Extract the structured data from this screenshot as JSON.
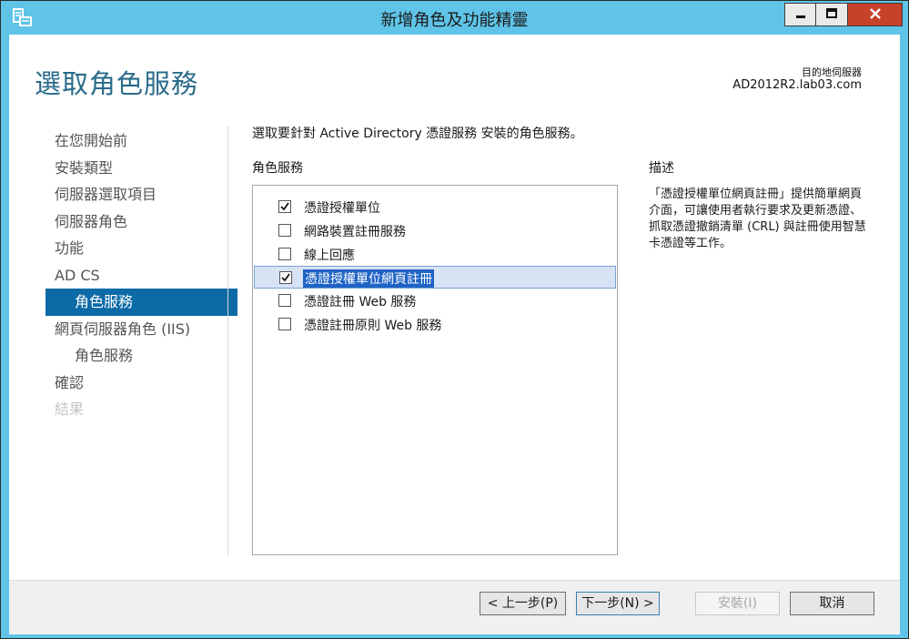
{
  "window": {
    "title": "新增角色及功能精靈",
    "icons": {
      "app": "server-manager-icon",
      "minimize": "minimize-icon",
      "maximize": "maximize-icon",
      "close": "close-icon"
    },
    "colors": {
      "titlebar": "#5fc4e8",
      "close_button": "#c7422a",
      "accent": "#0c6aa6",
      "page_title": "#2a6b89"
    }
  },
  "header": {
    "page_title": "選取角色服務",
    "destination_label": "目的地伺服器",
    "destination_server": "AD2012R2.lab03.com"
  },
  "nav": {
    "items": [
      {
        "label": "在您開始前",
        "state": "normal"
      },
      {
        "label": "安裝類型",
        "state": "normal"
      },
      {
        "label": "伺服器選取項目",
        "state": "normal"
      },
      {
        "label": "伺服器角色",
        "state": "normal"
      },
      {
        "label": "功能",
        "state": "normal"
      },
      {
        "label": "AD CS",
        "state": "normal"
      },
      {
        "label": "角色服務",
        "state": "active"
      },
      {
        "label": "網頁伺服器角色 (IIS)",
        "state": "normal"
      },
      {
        "label": "角色服務",
        "state": "normal"
      },
      {
        "label": "確認",
        "state": "normal"
      },
      {
        "label": "結果",
        "state": "disabled"
      }
    ]
  },
  "main": {
    "instruction": "選取要針對 Active Directory 憑證服務 安裝的角色服務。",
    "roles_header": "角色服務",
    "roles": [
      {
        "label": "憑證授權單位",
        "checked": true,
        "selected": false
      },
      {
        "label": "網路裝置註冊服務",
        "checked": false,
        "selected": false
      },
      {
        "label": "線上回應",
        "checked": false,
        "selected": false
      },
      {
        "label": "憑證授權單位網頁註冊",
        "checked": true,
        "selected": true
      },
      {
        "label": "憑證註冊 Web 服務",
        "checked": false,
        "selected": false
      },
      {
        "label": "憑證註冊原則 Web 服務",
        "checked": false,
        "selected": false
      }
    ],
    "description_header": "描述",
    "description_text": "「憑證授權單位網頁註冊」提供簡單網頁介面，可讓使用者執行要求及更新憑證、抓取憑證撤銷清單 (CRL) 與註冊使用智慧卡憑證等工作。"
  },
  "footer": {
    "prev_label": "< 上一步(P)",
    "next_label": "下一步(N) >",
    "install_label": "安裝(I)",
    "cancel_label": "取消"
  }
}
